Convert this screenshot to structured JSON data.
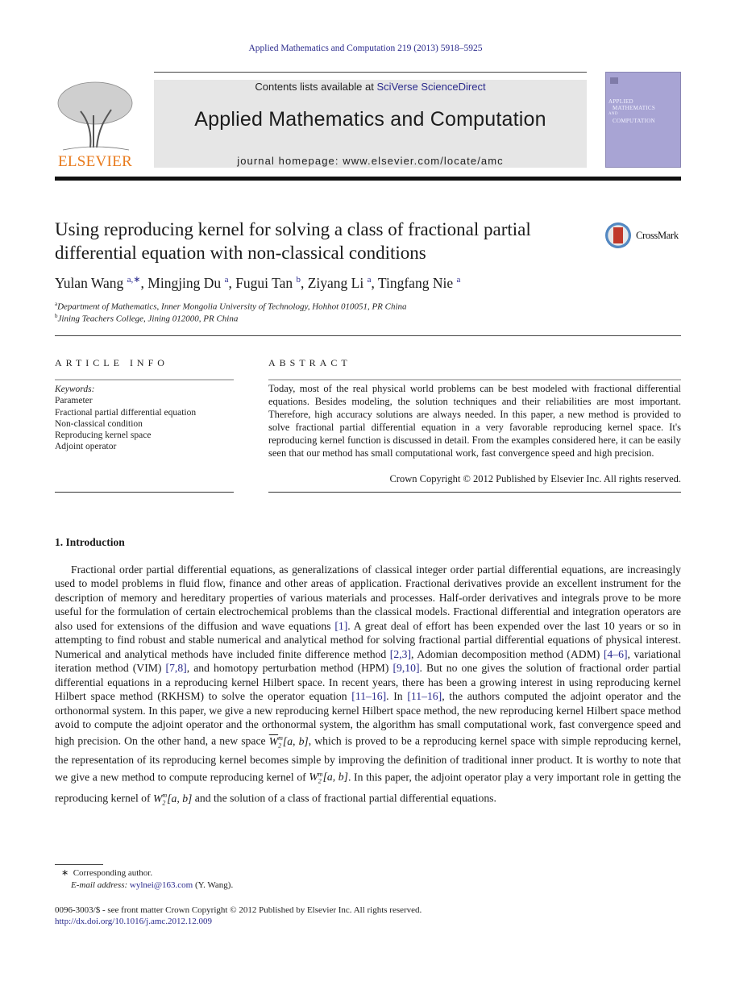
{
  "header": {
    "citation": "Applied Mathematics and Computation 219 (2013) 5918–5925",
    "contents_prefix": "Contents lists available at ",
    "contents_link": "SciVerse ScienceDirect",
    "journal_title": "Applied Mathematics and Computation",
    "homepage": "journal homepage: www.elsevier.com/locate/amc",
    "publisher_logo": "ELSEVIER",
    "cover_lines": [
      "APPLIED",
      "MATHEMATICS",
      "AND",
      "COMPUTATION"
    ],
    "crossmark": "CrossMark"
  },
  "article": {
    "title": "Using reproducing kernel for solving a class of fractional partial differential equation with non-classical conditions",
    "authors": [
      {
        "name": "Yulan Wang",
        "sup": "a,∗"
      },
      {
        "name": "Mingjing Du",
        "sup": "a"
      },
      {
        "name": "Fugui Tan",
        "sup": "b"
      },
      {
        "name": "Ziyang Li",
        "sup": "a"
      },
      {
        "name": "Tingfang Nie",
        "sup": "a"
      }
    ],
    "affiliations": [
      {
        "mark": "a",
        "text": "Department of Mathematics, Inner Mongolia University of Technology, Hohhot 010051, PR China"
      },
      {
        "mark": "b",
        "text": "Jining Teachers College, Jining 012000, PR China"
      }
    ]
  },
  "article_info": {
    "heading": "ARTICLE INFO",
    "keywords_label": "Keywords:",
    "keywords": [
      "Parameter",
      "Fractional partial differential equation",
      "Non-classical condition",
      "Reproducing kernel space",
      "Adjoint operator"
    ]
  },
  "abstract": {
    "heading": "ABSTRACT",
    "text": "Today, most of the real physical world problems can be best modeled with fractional differential equations. Besides modeling, the solution techniques and their reliabilities are most important. Therefore, high accuracy solutions are always needed. In this paper, a new method is provided to solve fractional partial differential equation in a very favorable reproducing kernel space. It's reproducing kernel function is discussed in detail. From the examples considered here, it can be easily seen that our method has small computational work, fast convergence speed and high precision.",
    "copyright": "Crown Copyright © 2012 Published by Elsevier Inc. All rights reserved."
  },
  "introduction": {
    "heading": "1. Introduction",
    "parts": {
      "p1": "Fractional order partial differential equations, as generalizations of classical integer order partial differential equations, are increasingly used to model problems in fluid flow, finance and other areas of application. Fractional derivatives provide an excellent instrument for the description of memory and hereditary properties of various materials and processes. Half-order derivatives and integrals prove to be more useful for the formulation of certain electrochemical problems than the classical models. Fractional differential and integration operators are also used for extensions of the diffusion and wave equations ",
      "r1": "[1]",
      "p2": ". A great deal of effort has been expended over the last 10 years or so in attempting to find robust and stable numerical and analytical method for solving fractional partial differential equations of physical interest. Numerical and analytical methods have included finite difference method ",
      "r2": "[2,3]",
      "p3": ", Adomian decomposition method (ADM) ",
      "r3": "[4–6]",
      "p4": ", variational iteration method (VIM) ",
      "r4": "[7,8]",
      "p5": ", and homotopy perturbation method (HPM) ",
      "r5": "[9,10]",
      "p6": ". But no one gives the solution of fractional order partial differential equations in a reproducing kernel Hilbert space. In recent years, there has been a growing interest in using reproducing kernel Hilbert space method (RKHSM) to solve the operator equation ",
      "r6": "[11–16]",
      "p7": ". In ",
      "r7": "[11–16]",
      "p8": ", the authors computed the adjoint operator and the orthonormal system. In this paper, we give a new reproducing kernel Hilbert space method, the new reproducing kernel Hilbert space method avoid to compute the adjoint operator and the orthonormal system, the algorithm has small computational work, fast convergence speed and high precision. On the other hand, a new space ",
      "m1": "W",
      "m1_tail": "[a, b]",
      "p9": ", which is proved to be a reproducing kernel space with simple reproducing kernel, the representation of its reproducing kernel becomes simple by improving the definition of traditional inner product. It is worthy to note that we give a new method to compute reproducing kernel of ",
      "m2": "W",
      "m2_tail": "[a, b]",
      "p10": ". In this paper, the adjoint operator play a very important role in getting the reproducing kernel of ",
      "m3": "W",
      "m3_tail": "[a, b]",
      "p11": " and the solution of a class of fractional partial differential equations.",
      "sup": "m",
      "sub": "2"
    }
  },
  "footnotes": {
    "star": "∗",
    "corresponding": "Corresponding author.",
    "email_label": "E-mail address:",
    "email": "wylnei@163.com",
    "email_suffix": " (Y. Wang).",
    "issn": "0096-3003/$ - see front matter Crown Copyright © 2012 Published by Elsevier Inc. All rights reserved.",
    "doi": "http://dx.doi.org/10.1016/j.amc.2012.12.009"
  }
}
